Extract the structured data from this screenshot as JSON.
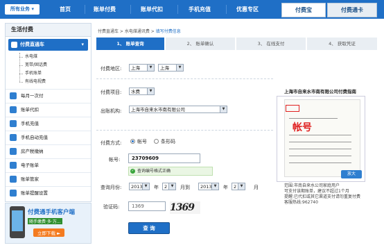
{
  "topnav": {
    "all_business": "所有业务 ▾",
    "items": [
      "首页",
      "账单付费",
      "账单代扣",
      "手机充值",
      "优惠专区"
    ],
    "buttons": [
      "付费宝",
      "付费通卡"
    ]
  },
  "sidebar": {
    "title": "生活付费",
    "section": "付费直通车",
    "section_arrow": "▾",
    "subitems": [
      "水电煤",
      "宽带/固话费",
      "手机账单",
      "有线电视费"
    ],
    "items": [
      "每月一次付",
      "账单代扣",
      "手机充值",
      "手机自动充值",
      "房产税缴纳",
      "电子账单",
      "账单管家",
      "账单提醒设置"
    ]
  },
  "promo": {
    "title": "付费通手机客户端",
    "tagline": "随手缴费·多·万...",
    "download": "立即下载 ►"
  },
  "breadcrumb": {
    "items": [
      "付费直通车",
      "水电煤通讯费"
    ],
    "current": "填写付费信息"
  },
  "steps": [
    "1、 账单查询",
    "2、 账单确认",
    "3、 在线支付",
    "4、 获取凭证"
  ],
  "form": {
    "region_label": "付费地区:",
    "region_province": "上海",
    "region_city": "上海",
    "item_label": "付费项目:",
    "item_value": "水费",
    "org_label": "出账机构:",
    "org_value": "上海市自来水市南有限公司",
    "method_label": "付费方式:",
    "method_options": [
      "帐号",
      "条形码"
    ],
    "account_label": "帐号:",
    "account_value": "23709609",
    "account_ok": "查询编号格式正确",
    "month_label": "查询月份:",
    "from_year": "2013",
    "from_year_unit": "年",
    "from_month": "2",
    "to_sep": "月到",
    "to_year": "2013",
    "to_year_unit": "年",
    "to_month": "2",
    "to_month_unit": "月",
    "captcha_label": "验证码:",
    "captcha_input": "1369",
    "captcha_image_text": "1369",
    "query_button": "查 询"
  },
  "guide": {
    "title": "上海市自来水市南有限公司付费指南",
    "bill_mark": "帐号",
    "zoom": "放大",
    "text_lines": [
      "范围:市南自来水公司家庭用户",
      "可支付该期账单，建议不超过1个月",
      "提醒:已代扣或其它渠道支付请勿重复付费",
      "客服热线:962740"
    ]
  },
  "colors": {
    "primary": "#1f6fc6",
    "ok": "#39a53b",
    "alert": "#e02020"
  }
}
